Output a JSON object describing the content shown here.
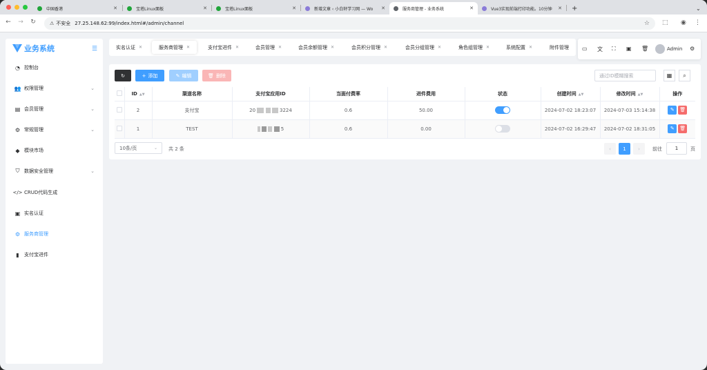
{
  "browser": {
    "tabs": [
      {
        "title": "中国香港",
        "active": false
      },
      {
        "title": "宝塔Linux面板",
        "active": false
      },
      {
        "title": "宝塔Linux面板",
        "active": false
      },
      {
        "title": "新增文章 ‹ 小白轩学习网 — Wo",
        "active": false
      },
      {
        "title": "服务商管理 - 业务系统",
        "active": true
      },
      {
        "title": "Vue3实现前端打印功能。10分钟",
        "active": false
      }
    ],
    "new_tab": "+",
    "security_label": "不安全",
    "url": "27.25.148.62:99/index.html#/admin/channel"
  },
  "sidebar": {
    "logo": "业务系统",
    "items": [
      {
        "label": "控制台",
        "icon": "dashboard-icon",
        "has_arrow": false
      },
      {
        "label": "权限管理",
        "icon": "users-icon",
        "has_arrow": true
      },
      {
        "label": "会员管理",
        "icon": "id-card-icon",
        "has_arrow": true
      },
      {
        "label": "常规管理",
        "icon": "cogs-icon",
        "has_arrow": true
      },
      {
        "label": "模块市场",
        "icon": "bag-icon",
        "has_arrow": false
      },
      {
        "label": "数据安全管理",
        "icon": "shield-icon",
        "has_arrow": true
      },
      {
        "label": "CRUD代码生成",
        "icon": "code-icon",
        "has_arrow": false
      },
      {
        "label": "实名认证",
        "icon": "id-badge-icon",
        "has_arrow": false
      },
      {
        "label": "服务商管理",
        "icon": "gear-icon",
        "has_arrow": false,
        "active": true
      },
      {
        "label": "支付宝进件",
        "icon": "bar-chart-icon",
        "has_arrow": false
      }
    ]
  },
  "nav_tabs": [
    {
      "label": "实名认证",
      "active": false
    },
    {
      "label": "服务商管理",
      "active": true
    },
    {
      "label": "支付宝进件",
      "active": false
    },
    {
      "label": "会员管理",
      "active": false
    },
    {
      "label": "会员余额管理",
      "active": false
    },
    {
      "label": "会员积分管理",
      "active": false
    },
    {
      "label": "会员分组管理",
      "active": false
    },
    {
      "label": "角色组管理",
      "active": false
    },
    {
      "label": "系统配置",
      "active": false
    },
    {
      "label": "附件管理",
      "active": false
    }
  ],
  "user": {
    "name": "Admin"
  },
  "toolbar": {
    "refresh_icon": "refresh-icon",
    "add_label": "添加",
    "edit_label": "编辑",
    "delete_label": "删除",
    "search_placeholder": "通过ID模糊搜索"
  },
  "table": {
    "headers": [
      "ID",
      "渠道名称",
      "支付宝应用ID",
      "当面付费率",
      "进件费用",
      "状态",
      "创建时间",
      "修改时间",
      "操作"
    ],
    "rows": [
      {
        "id": "2",
        "name": "支付宝",
        "app_id_prefix": "20",
        "app_id_suffix": "3224",
        "rate": "0.6",
        "fee": "50.00",
        "status": true,
        "created": "2024-07-02 18:23:07",
        "modified": "2024-07-03 15:14:38"
      },
      {
        "id": "1",
        "name": "TEST",
        "app_id_prefix": "",
        "app_id_suffix": "5",
        "rate": "0.6",
        "fee": "0.00",
        "status": false,
        "created": "2024-07-02 16:29:47",
        "modified": "2024-07-02 18:31:05"
      }
    ]
  },
  "pagination": {
    "page_size": "10条/页",
    "total": "共 2 条",
    "current_page": "1",
    "goto_label": "前往",
    "goto_value": "1",
    "page_unit": "页"
  },
  "colors": {
    "primary": "#409eff",
    "danger": "#f56c6c",
    "dark_button": "#303133"
  }
}
